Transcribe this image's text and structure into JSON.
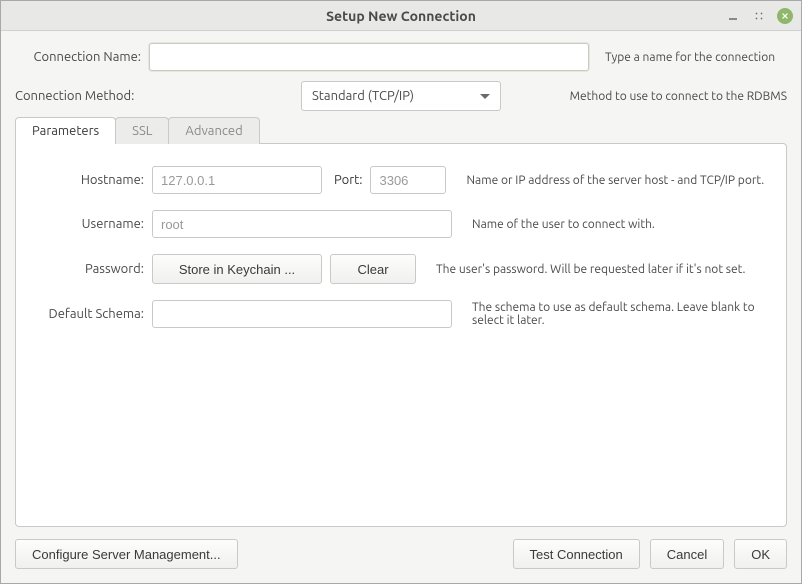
{
  "window": {
    "title": "Setup New Connection"
  },
  "form": {
    "connectionName": {
      "label": "Connection Name:",
      "value": "",
      "help": "Type a name for the connection"
    },
    "connectionMethod": {
      "label": "Connection Method:",
      "selected": "Standard (TCP/IP)",
      "help": "Method to use to connect to the RDBMS"
    }
  },
  "tabs": [
    {
      "label": "Parameters",
      "active": true
    },
    {
      "label": "SSL",
      "active": false
    },
    {
      "label": "Advanced",
      "active": false
    }
  ],
  "params": {
    "hostname": {
      "label": "Hostname:",
      "placeholder": "127.0.0.1",
      "value": ""
    },
    "port": {
      "label": "Port:",
      "placeholder": "3306",
      "value": ""
    },
    "hostHelp": "Name or IP address of the server host - and TCP/IP port.",
    "username": {
      "label": "Username:",
      "placeholder": "root",
      "value": "",
      "help": "Name of the user to connect with."
    },
    "password": {
      "label": "Password:",
      "storeBtn": "Store in Keychain ...",
      "clearBtn": "Clear",
      "help": "The user's password. Will be requested later if it's not set."
    },
    "schema": {
      "label": "Default Schema:",
      "value": "",
      "help": "The schema to use as default schema. Leave blank to select it later."
    }
  },
  "footer": {
    "configure": "Configure Server Management...",
    "test": "Test Connection",
    "cancel": "Cancel",
    "ok": "OK"
  }
}
